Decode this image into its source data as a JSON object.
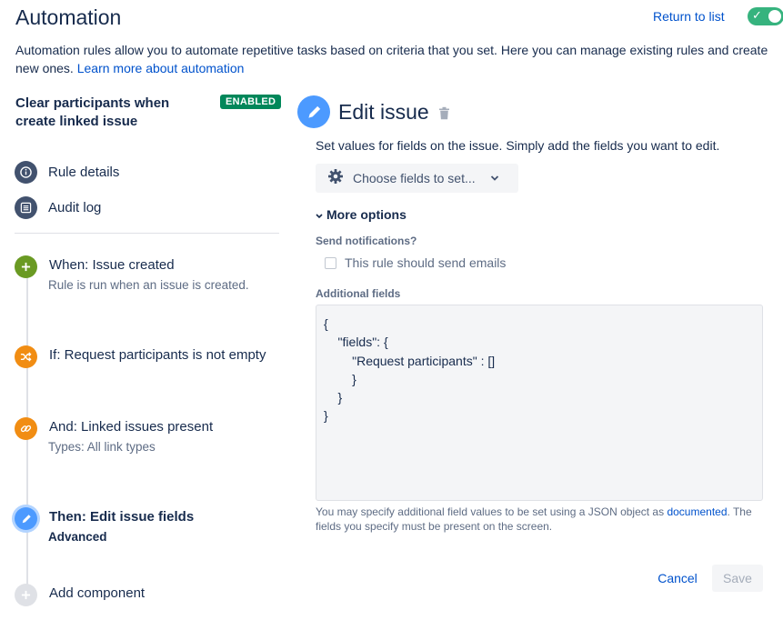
{
  "header": {
    "title": "Automation",
    "return_link": "Return to list",
    "toggle_on": true
  },
  "intro": {
    "text": "Automation rules allow you to automate repetitive tasks based on criteria that you set. Here you can manage existing rules and create new ones. ",
    "link": "Learn more about automation"
  },
  "rule": {
    "name": "Clear participants when create linked issue",
    "status": "ENABLED"
  },
  "nav": {
    "rule_details": "Rule details",
    "audit_log": "Audit log"
  },
  "steps": [
    {
      "title": "When: Issue created",
      "subtitle": "Rule is run when an issue is created.",
      "color": "#6a9a23",
      "icon": "plus-icon"
    },
    {
      "title": "If: Request participants is not empty",
      "subtitle": "",
      "color": "#f18d13",
      "icon": "shuffle-icon"
    },
    {
      "title": "And: Linked issues present",
      "subtitle": "Types: All link types",
      "color": "#f18d13",
      "icon": "link-icon"
    },
    {
      "title": "Then: Edit issue fields",
      "subtitle": "Advanced",
      "color": "#4c9aff",
      "icon": "pencil-icon"
    },
    {
      "title": "Add component",
      "subtitle": "",
      "color": "#dfe1e6",
      "icon": "plus-icon"
    }
  ],
  "editor": {
    "title": "Edit issue",
    "description": "Set values for fields on the issue. Simply add the fields you want to edit.",
    "choose_fields": "Choose fields to set...",
    "more_options": "More options",
    "send_notifications_label": "Send notifications?",
    "send_notifications_checkbox": "This rule should send emails",
    "send_notifications_checked": false,
    "additional_fields_label": "Additional fields",
    "additional_fields_value": "{\n    \"fields\": {\n        \"Request participants\" : []\n        }\n    }\n}",
    "helper_text_1": "You may specify additional field values to be set using a JSON object as ",
    "helper_link": "documented",
    "helper_text_2": ". The fields you specify must be present on the screen.",
    "cancel": "Cancel",
    "save": "Save"
  },
  "colors": {
    "accent": "#0052cc",
    "enabled_badge": "#00875a",
    "toggle": "#36b37e",
    "edit_icon": "#4c9aff"
  }
}
